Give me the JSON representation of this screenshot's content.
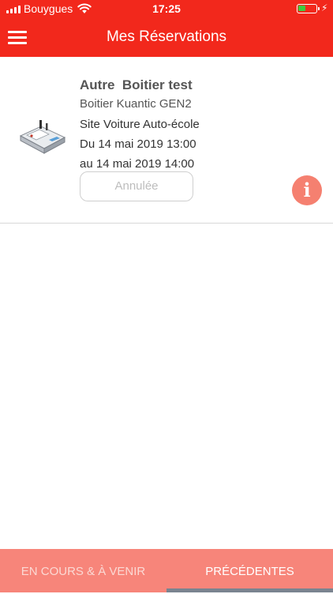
{
  "status_bar": {
    "carrier": "Bouygues",
    "time": "17:25",
    "battery_color": "#3ecb3e"
  },
  "header": {
    "title": "Mes Réservations",
    "menu_icon": "hamburger-menu-icon",
    "background_color": "#f2281c"
  },
  "reservation": {
    "title": "Autre  Boitier test",
    "device_name": "Boitier Kuantic GEN2",
    "site": "Site Voiture Auto-école",
    "start": "Du 14 mai 2019 13:00",
    "end": "au 14 mai 2019 14:00",
    "status_label": "Annulée",
    "info_label": "i",
    "info_color": "#f58070"
  },
  "tabs": [
    {
      "label": "EN COURS & À VENIR",
      "active": false
    },
    {
      "label": "PRÉCÉDENTES",
      "active": true
    }
  ]
}
